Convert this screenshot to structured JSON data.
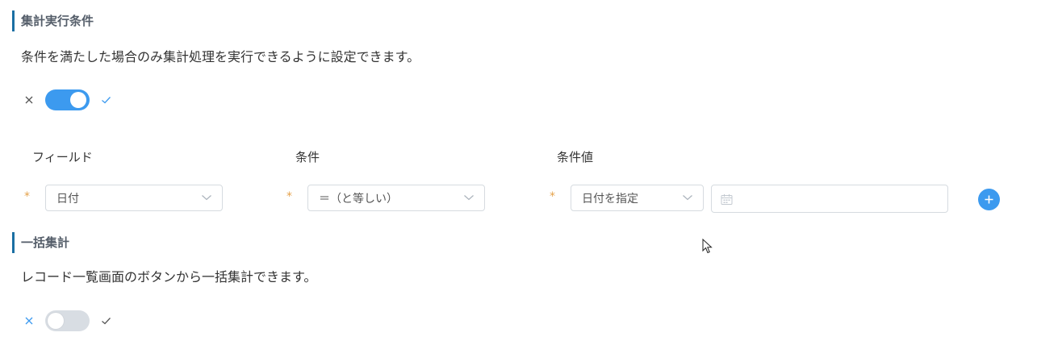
{
  "section1": {
    "title": "集計実行条件",
    "description": "条件を満たした場合のみ集計処理を実行できるように設定できます。",
    "toggle": {
      "state": "on",
      "off_icon": "close-icon",
      "on_icon": "check-icon"
    }
  },
  "condition": {
    "columns": {
      "field": "フィールド",
      "condition": "条件",
      "value": "条件値"
    },
    "required_mark": "*",
    "field_select": "日付",
    "operator_select": "＝（と等しい）",
    "value_type_select": "日付を指定",
    "date_input": "",
    "add_button": "+"
  },
  "section2": {
    "title": "一括集計",
    "description": "レコード一覧画面のボタンから一括集計できます。",
    "toggle": {
      "state": "off",
      "off_icon": "close-icon",
      "on_icon": "check-icon"
    }
  },
  "colors": {
    "accent": "#3c9aef",
    "section_bar": "#1a6fa3",
    "required": "#e5a24b",
    "toggle_off": "#d8dde3"
  }
}
